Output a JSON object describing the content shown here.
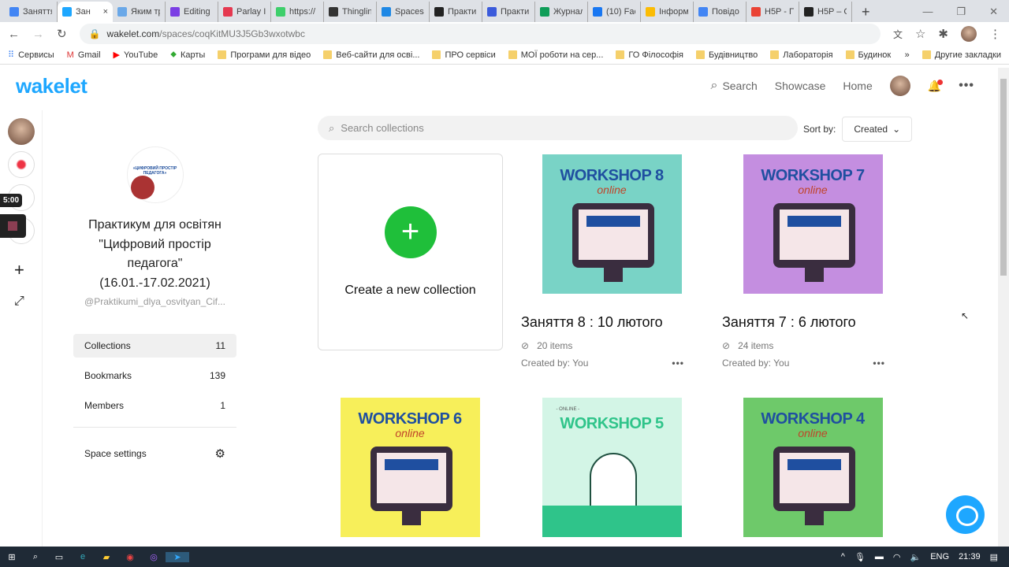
{
  "browser": {
    "tabs": [
      {
        "label": "Заняття",
        "color": "#4285f4"
      },
      {
        "label": "Зан",
        "color": "#1ea7ff",
        "active": true
      },
      {
        "label": "Яким тр",
        "color": "#6aa8e8"
      },
      {
        "label": "Editing",
        "color": "#7b3fe4"
      },
      {
        "label": "Parlay Id",
        "color": "#e53950"
      },
      {
        "label": "https://",
        "color": "#3ecf6b"
      },
      {
        "label": "Thinglin",
        "color": "#333333"
      },
      {
        "label": "Spaces",
        "color": "#1e88e5"
      },
      {
        "label": "Практи",
        "color": "#222222"
      },
      {
        "label": "Практи",
        "color": "#3b5bdb"
      },
      {
        "label": "Журнал",
        "color": "#0f9d58"
      },
      {
        "label": "(10) Fac",
        "color": "#1877f2"
      },
      {
        "label": "Інформ",
        "color": "#fbbc04"
      },
      {
        "label": "Повідо",
        "color": "#4285f4"
      },
      {
        "label": "H5P - П",
        "color": "#ea4335"
      },
      {
        "label": "H5P – С",
        "color": "#222222"
      }
    ],
    "close_tab": "×",
    "new_tab": "+",
    "window_controls": [
      "—",
      "❐",
      "✕"
    ],
    "url_host": "wakelet.com",
    "url_path": "/spaces/coqKitMU3J5Gb3wxotwbc",
    "bookmarks": [
      "Сервисы",
      "Gmail",
      "YouTube",
      "Карты",
      "Програми для відео",
      "Веб-сайти для осві...",
      "ПРО сервіси",
      "МОЇ роботи на сер...",
      "ГО Філософія",
      "Будівництво",
      "Лабораторія",
      "Будинок"
    ],
    "bookmarks_more": "»",
    "other_bookmarks": "Другие закладки"
  },
  "header": {
    "logo": "wakelet",
    "search": "Search",
    "showcase": "Showcase",
    "home": "Home"
  },
  "rail": {
    "timer": "5:00",
    "add": "+",
    "expand": "⤢"
  },
  "space": {
    "logo_text": "«ЦИФРОВИЙ ПРОСТІР ПЕДАГОГА»",
    "title_lines": [
      "Практикум для освітян",
      "\"Цифровий простір",
      "педагога\"",
      "(16.01.-17.02.2021)"
    ],
    "handle": "@Praktikumi_dlya_osvityan_Cif...",
    "menu": [
      {
        "label": "Collections",
        "count": "11"
      },
      {
        "label": "Bookmarks",
        "count": "139"
      },
      {
        "label": "Members",
        "count": "1"
      }
    ],
    "settings": "Space settings"
  },
  "main": {
    "search_placeholder": "Search collections",
    "sort_label": "Sort by:",
    "sort_value": "Created",
    "create_label": "Create a new collection",
    "collections": [
      {
        "thumb_title": "WORKSHOP 8",
        "thumb_sub": "online",
        "bg": "#79d3c6",
        "title": "Заняття 8 : 10 лютого",
        "items": "20 items",
        "by": "Created by: You"
      },
      {
        "thumb_title": "WORKSHOP 7",
        "thumb_sub": "online",
        "bg": "#c48ee0",
        "title": "Заняття 7 : 6 лютого",
        "items": "24 items",
        "by": "Created by: You"
      },
      {
        "thumb_title": "WORKSHOP 6",
        "thumb_sub": "online",
        "bg": "#f7ef5a"
      },
      {
        "thumb_title": "WORKSHOP 5",
        "thumb_sub": "- ONLINE -",
        "bg": "#d3f5e6"
      },
      {
        "thumb_title": "WORKSHOP 4",
        "thumb_sub": "online",
        "bg": "#6ec96a"
      }
    ]
  },
  "taskbar": {
    "lang": "ENG",
    "time": "21:39"
  }
}
